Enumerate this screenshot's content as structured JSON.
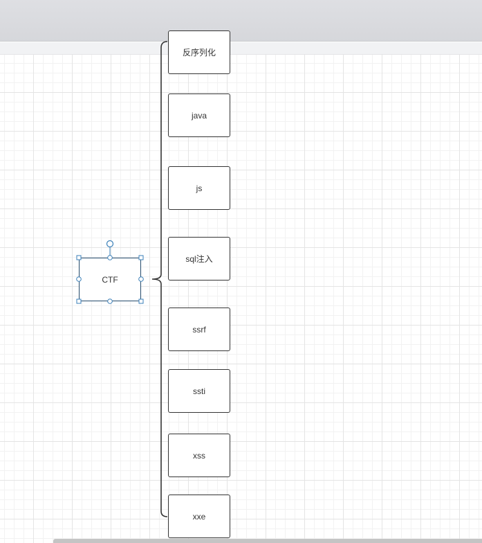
{
  "diagram": {
    "root": {
      "label": "CTF",
      "selected": true
    },
    "children": [
      {
        "label": "反序列化"
      },
      {
        "label": "java"
      },
      {
        "label": "js"
      },
      {
        "label": "sql注入"
      },
      {
        "label": "ssrf"
      },
      {
        "label": "ssti"
      },
      {
        "label": "xss"
      },
      {
        "label": "xxe"
      }
    ]
  },
  "colors": {
    "node_border": "#333333",
    "selection": "#3a7fb8",
    "selected_border": "#234a6b",
    "grid_major": "#e4e4e4",
    "grid_minor": "#f2f2f2"
  },
  "icons": {
    "rotate_handle": "rotate-handle-icon",
    "resize_handle": "resize-handle-icon",
    "connection_point": "connection-point-icon"
  }
}
